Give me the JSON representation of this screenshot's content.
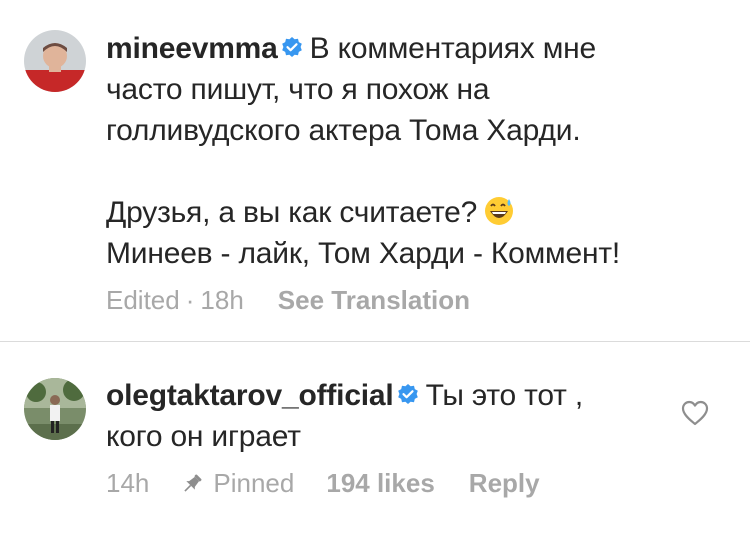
{
  "caption": {
    "username": "mineevmma",
    "verified": true,
    "line1": "В комментариях мне",
    "line2": "часто пишут, что я похож на",
    "line3": "голливудского актера Тома Харди.",
    "line4": "Друзья, а вы как считаете?",
    "line4_emoji": "grinning-face-with-sweat-emoji",
    "line5": "Минеев - лайк, Том Харди - Коммент!",
    "edited_label": "Edited",
    "separator": "·",
    "time": "18h",
    "see_translation_label": "See Translation"
  },
  "comment": {
    "username": "olegtaktarov_official",
    "verified": true,
    "text_line1": "Ты это тот ,",
    "text_line2": "кого он играет",
    "time": "14h",
    "pin_icon": "pin-icon",
    "pinned_label": "Pinned",
    "likes_label": "194 likes",
    "reply_label": "Reply",
    "like_icon": "heart-outline-icon"
  },
  "colors": {
    "text": "#262626",
    "secondary": "#a8a8a8",
    "verified_blue": "#3897f0",
    "divider": "#dbdbdb"
  }
}
